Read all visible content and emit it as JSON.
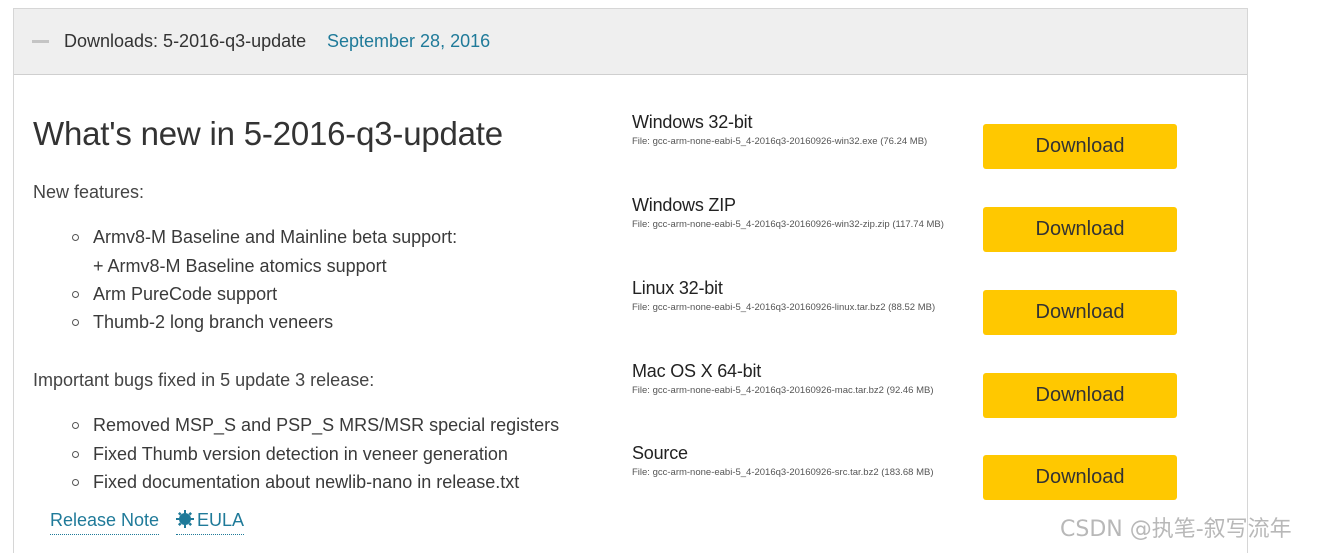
{
  "header": {
    "title": "Downloads: 5-2016-q3-update",
    "date": "September 28, 2016"
  },
  "whats_new": {
    "title": "What's new in 5-2016-q3-update",
    "features_heading": "New features:",
    "features": [
      "Armv8-M Baseline and Mainline beta support:",
      "+ Armv8-M Baseline atomics support",
      "Arm PureCode support",
      "Thumb-2 long branch veneers"
    ],
    "bugs_heading": "Important bugs fixed in 5 update 3 release:",
    "bugs": [
      "Removed MSP_S and PSP_S MRS/MSR special registers",
      "Fixed Thumb version detection in veneer generation",
      "Fixed documentation about newlib-nano in release.txt"
    ]
  },
  "footer": {
    "release_note": "Release Note",
    "eula": "EULA"
  },
  "downloads": [
    {
      "name": "Windows 32-bit",
      "file": "File: gcc-arm-none-eabi-5_4-2016q3-20160926-win32.exe (76.24 MB)",
      "button": "Download"
    },
    {
      "name": "Windows ZIP",
      "file": "File: gcc-arm-none-eabi-5_4-2016q3-20160926-win32-zip.zip (117.74 MB)",
      "button": "Download"
    },
    {
      "name": "Linux 32-bit",
      "file": "File: gcc-arm-none-eabi-5_4-2016q3-20160926-linux.tar.bz2 (88.52 MB)",
      "button": "Download"
    },
    {
      "name": "Mac OS X 64-bit",
      "file": "File: gcc-arm-none-eabi-5_4-2016q3-20160926-mac.tar.bz2 (92.46 MB)",
      "button": "Download"
    },
    {
      "name": "Source",
      "file": "File: gcc-arm-none-eabi-5_4-2016q3-20160926-src.tar.bz2 (183.68 MB)",
      "button": "Download"
    }
  ],
  "watermark": "CSDN @执笔-叙写流年",
  "colors": {
    "accent_link": "#1f7a99",
    "download_button": "#ffc800",
    "header_bg": "#efefef"
  }
}
